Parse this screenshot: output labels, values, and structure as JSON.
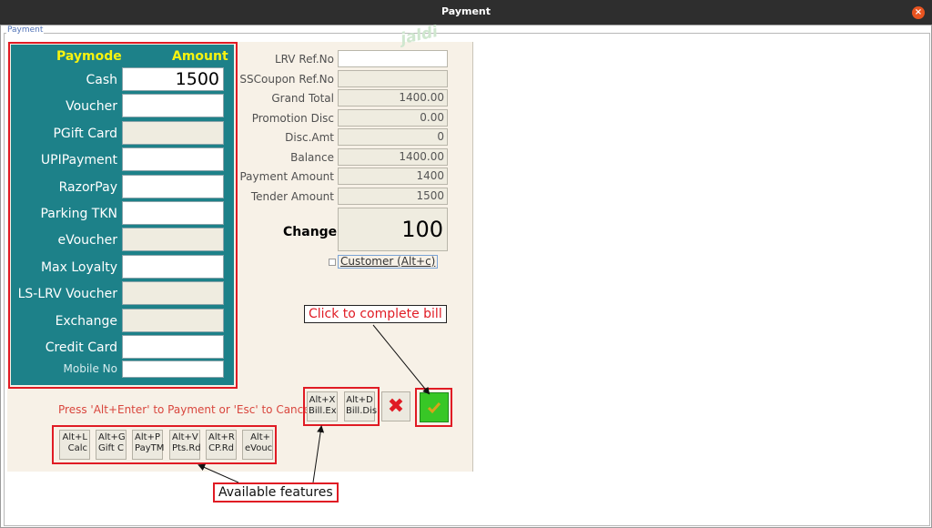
{
  "window": {
    "title": "Payment"
  },
  "group_label": "Payment",
  "paymodes": {
    "header_mode": "Paymode",
    "header_amount": "Amount",
    "rows": [
      {
        "label": "Cash",
        "value": "1500",
        "disabled": false
      },
      {
        "label": "Voucher",
        "value": "",
        "disabled": false
      },
      {
        "label": "PGift Card",
        "value": "",
        "disabled": true
      },
      {
        "label": "UPIPayment",
        "value": "",
        "disabled": false
      },
      {
        "label": "RazorPay",
        "value": "",
        "disabled": false
      },
      {
        "label": "Parking TKN",
        "value": "",
        "disabled": false
      },
      {
        "label": "eVoucher",
        "value": "",
        "disabled": true
      },
      {
        "label": "Max Loyalty",
        "value": "",
        "disabled": false
      },
      {
        "label": "LS-LRV Voucher",
        "value": "",
        "disabled": true
      },
      {
        "label": "Exchange",
        "value": "",
        "disabled": true
      },
      {
        "label": "Credit Card",
        "value": "",
        "disabled": false
      }
    ],
    "mobile_label": "Mobile No"
  },
  "summary": {
    "rows": [
      {
        "label": "LRV Ref.No",
        "value": "",
        "white": true
      },
      {
        "label": "SSCoupon Ref.No",
        "value": "",
        "white": false
      },
      {
        "label": "Grand Total",
        "value": "1400.00",
        "white": false
      },
      {
        "label": "Promotion Disc",
        "value": "0.00",
        "white": false
      },
      {
        "label": "Disc.Amt",
        "value": "0",
        "white": false
      },
      {
        "label": "Balance",
        "value": "1400.00",
        "white": false
      },
      {
        "label": "Payment Amount",
        "value": "1400",
        "white": false
      },
      {
        "label": "Tender Amount",
        "value": "1500",
        "white": false
      }
    ],
    "change_label": "Change",
    "change_value": "100",
    "customer_label": "Customer (Alt+c)"
  },
  "hint": "Press 'Alt+Enter' to Payment or 'Esc' to Cancel",
  "feature_keys": [
    {
      "line1": "Alt+L",
      "line2": "Calc"
    },
    {
      "line1": "Alt+G",
      "line2": "Gift C"
    },
    {
      "line1": "Alt+P",
      "line2": "PayTM"
    },
    {
      "line1": "Alt+V",
      "line2": "Pts.Rd"
    },
    {
      "line1": "Alt+R",
      "line2": "CP.Rd"
    },
    {
      "line1": "Alt+",
      "line2": "eVouc"
    }
  ],
  "side_keys": [
    {
      "line1": "Alt+X",
      "line2": "Bill.Ex"
    },
    {
      "line1": "Alt+D",
      "line2": "Bill.Dis"
    }
  ],
  "buttons": {
    "cancel": "✖",
    "ok": "✔"
  },
  "annotations": {
    "complete": "Click to complete bill",
    "features": "Available features"
  },
  "watermark": "jaldi",
  "colors": {
    "panel": "#1d8189",
    "header": "#f7f30f",
    "annotation": "#e01b24",
    "ok": "#38c726"
  }
}
